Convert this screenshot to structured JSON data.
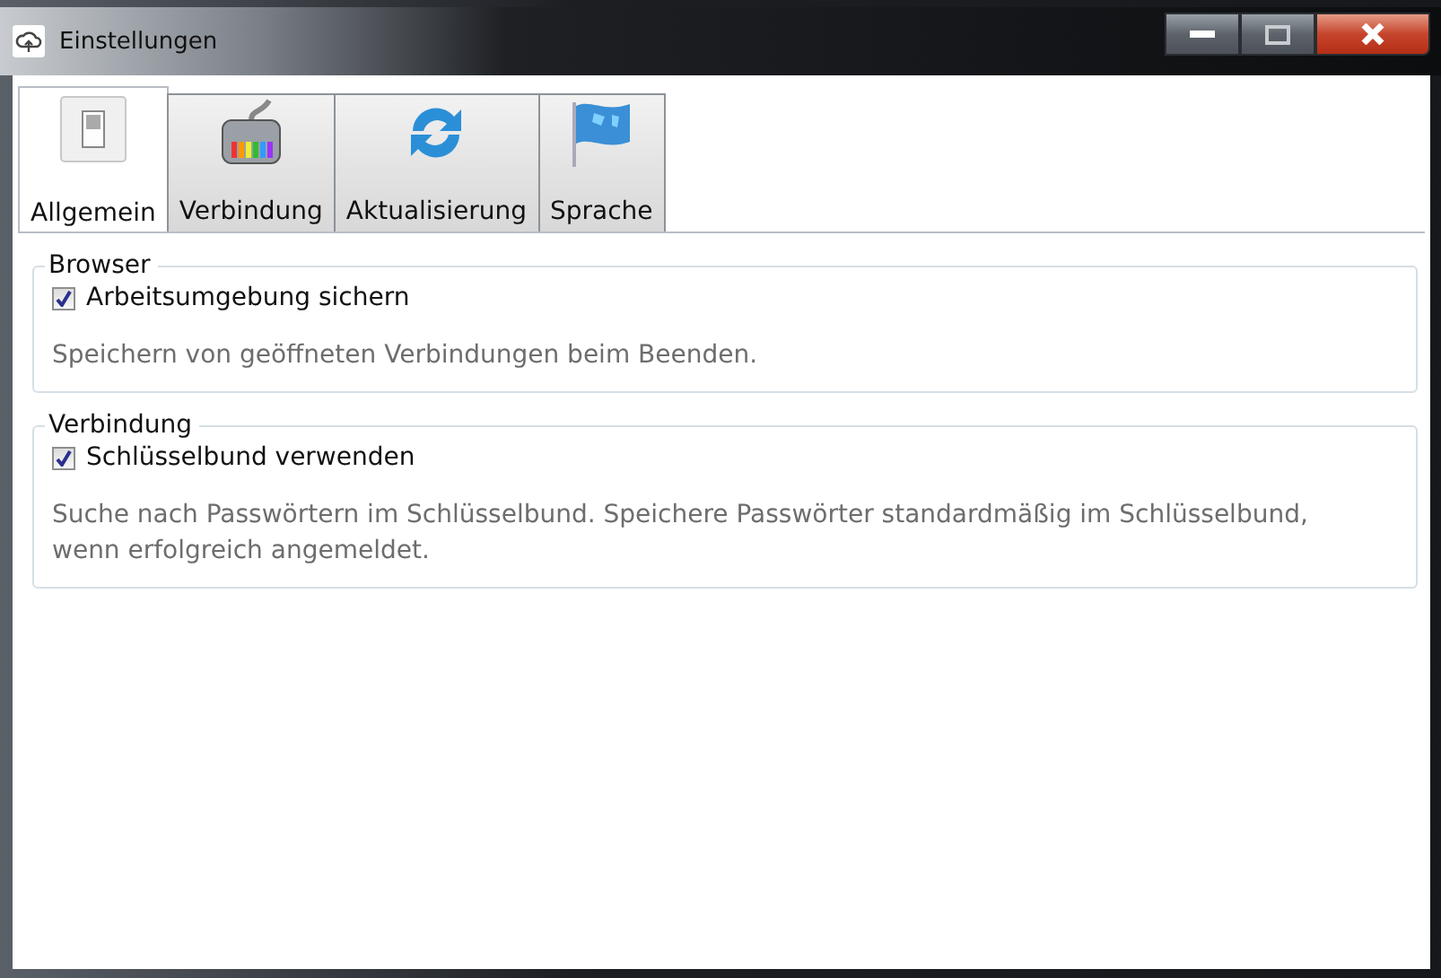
{
  "window": {
    "title": "Einstellungen"
  },
  "tabs": [
    {
      "label": "Allgemein",
      "selected": true
    },
    {
      "label": "Verbindung",
      "selected": false
    },
    {
      "label": "Aktualisierung",
      "selected": false
    },
    {
      "label": "Sprache",
      "selected": false
    }
  ],
  "groups": [
    {
      "title": "Browser",
      "option": {
        "label": "Arbeitsumgebung sichern",
        "checked": true
      },
      "description": "Speichern von geöffneten Verbindungen beim Beenden."
    },
    {
      "title": "Verbindung",
      "option": {
        "label": "Schlüsselbund verwenden",
        "checked": true
      },
      "description": "Suche nach Passwörtern im Schlüsselbund. Speichere Passwörter standardmäßig im Schlüsselbund, wenn erfolgreich angemeldet."
    }
  ]
}
